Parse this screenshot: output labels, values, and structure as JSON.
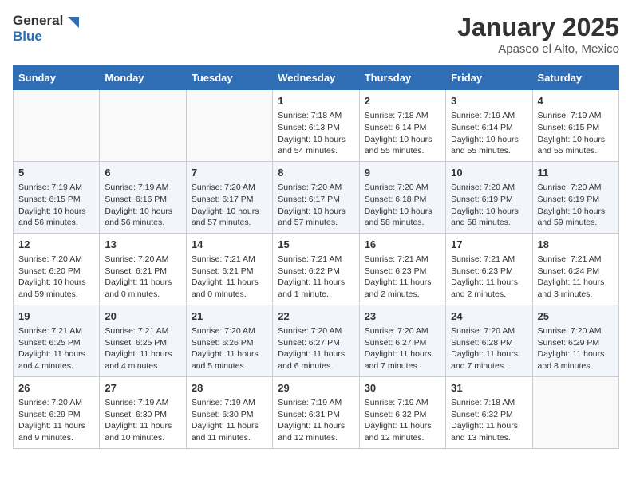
{
  "logo": {
    "general": "General",
    "blue": "Blue"
  },
  "title": "January 2025",
  "subtitle": "Apaseo el Alto, Mexico",
  "days_of_week": [
    "Sunday",
    "Monday",
    "Tuesday",
    "Wednesday",
    "Thursday",
    "Friday",
    "Saturday"
  ],
  "weeks": [
    [
      {
        "day": "",
        "info": ""
      },
      {
        "day": "",
        "info": ""
      },
      {
        "day": "",
        "info": ""
      },
      {
        "day": "1",
        "info": "Sunrise: 7:18 AM\nSunset: 6:13 PM\nDaylight: 10 hours and 54 minutes."
      },
      {
        "day": "2",
        "info": "Sunrise: 7:18 AM\nSunset: 6:14 PM\nDaylight: 10 hours and 55 minutes."
      },
      {
        "day": "3",
        "info": "Sunrise: 7:19 AM\nSunset: 6:14 PM\nDaylight: 10 hours and 55 minutes."
      },
      {
        "day": "4",
        "info": "Sunrise: 7:19 AM\nSunset: 6:15 PM\nDaylight: 10 hours and 55 minutes."
      }
    ],
    [
      {
        "day": "5",
        "info": "Sunrise: 7:19 AM\nSunset: 6:15 PM\nDaylight: 10 hours and 56 minutes."
      },
      {
        "day": "6",
        "info": "Sunrise: 7:19 AM\nSunset: 6:16 PM\nDaylight: 10 hours and 56 minutes."
      },
      {
        "day": "7",
        "info": "Sunrise: 7:20 AM\nSunset: 6:17 PM\nDaylight: 10 hours and 57 minutes."
      },
      {
        "day": "8",
        "info": "Sunrise: 7:20 AM\nSunset: 6:17 PM\nDaylight: 10 hours and 57 minutes."
      },
      {
        "day": "9",
        "info": "Sunrise: 7:20 AM\nSunset: 6:18 PM\nDaylight: 10 hours and 58 minutes."
      },
      {
        "day": "10",
        "info": "Sunrise: 7:20 AM\nSunset: 6:19 PM\nDaylight: 10 hours and 58 minutes."
      },
      {
        "day": "11",
        "info": "Sunrise: 7:20 AM\nSunset: 6:19 PM\nDaylight: 10 hours and 59 minutes."
      }
    ],
    [
      {
        "day": "12",
        "info": "Sunrise: 7:20 AM\nSunset: 6:20 PM\nDaylight: 10 hours and 59 minutes."
      },
      {
        "day": "13",
        "info": "Sunrise: 7:20 AM\nSunset: 6:21 PM\nDaylight: 11 hours and 0 minutes."
      },
      {
        "day": "14",
        "info": "Sunrise: 7:21 AM\nSunset: 6:21 PM\nDaylight: 11 hours and 0 minutes."
      },
      {
        "day": "15",
        "info": "Sunrise: 7:21 AM\nSunset: 6:22 PM\nDaylight: 11 hours and 1 minute."
      },
      {
        "day": "16",
        "info": "Sunrise: 7:21 AM\nSunset: 6:23 PM\nDaylight: 11 hours and 2 minutes."
      },
      {
        "day": "17",
        "info": "Sunrise: 7:21 AM\nSunset: 6:23 PM\nDaylight: 11 hours and 2 minutes."
      },
      {
        "day": "18",
        "info": "Sunrise: 7:21 AM\nSunset: 6:24 PM\nDaylight: 11 hours and 3 minutes."
      }
    ],
    [
      {
        "day": "19",
        "info": "Sunrise: 7:21 AM\nSunset: 6:25 PM\nDaylight: 11 hours and 4 minutes."
      },
      {
        "day": "20",
        "info": "Sunrise: 7:21 AM\nSunset: 6:25 PM\nDaylight: 11 hours and 4 minutes."
      },
      {
        "day": "21",
        "info": "Sunrise: 7:20 AM\nSunset: 6:26 PM\nDaylight: 11 hours and 5 minutes."
      },
      {
        "day": "22",
        "info": "Sunrise: 7:20 AM\nSunset: 6:27 PM\nDaylight: 11 hours and 6 minutes."
      },
      {
        "day": "23",
        "info": "Sunrise: 7:20 AM\nSunset: 6:27 PM\nDaylight: 11 hours and 7 minutes."
      },
      {
        "day": "24",
        "info": "Sunrise: 7:20 AM\nSunset: 6:28 PM\nDaylight: 11 hours and 7 minutes."
      },
      {
        "day": "25",
        "info": "Sunrise: 7:20 AM\nSunset: 6:29 PM\nDaylight: 11 hours and 8 minutes."
      }
    ],
    [
      {
        "day": "26",
        "info": "Sunrise: 7:20 AM\nSunset: 6:29 PM\nDaylight: 11 hours and 9 minutes."
      },
      {
        "day": "27",
        "info": "Sunrise: 7:19 AM\nSunset: 6:30 PM\nDaylight: 11 hours and 10 minutes."
      },
      {
        "day": "28",
        "info": "Sunrise: 7:19 AM\nSunset: 6:30 PM\nDaylight: 11 hours and 11 minutes."
      },
      {
        "day": "29",
        "info": "Sunrise: 7:19 AM\nSunset: 6:31 PM\nDaylight: 11 hours and 12 minutes."
      },
      {
        "day": "30",
        "info": "Sunrise: 7:19 AM\nSunset: 6:32 PM\nDaylight: 11 hours and 12 minutes."
      },
      {
        "day": "31",
        "info": "Sunrise: 7:18 AM\nSunset: 6:32 PM\nDaylight: 11 hours and 13 minutes."
      },
      {
        "day": "",
        "info": ""
      }
    ]
  ]
}
